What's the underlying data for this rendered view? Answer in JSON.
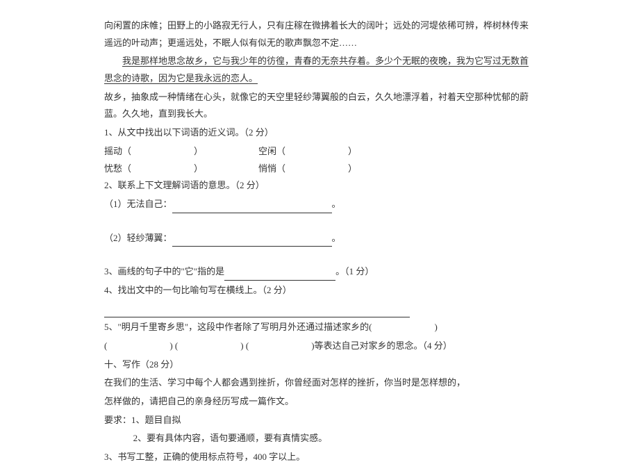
{
  "passage": {
    "p1": "向闲置的床帷；田野上的小路寂无行人，只有庄稼在微拂着长大的阔叶；远处的河堤依稀可辨，桦树林传来遥远的叶动声；更遥远处，不眠人似有似无的歌声飘忽不定……",
    "p2_underline": "我是那样地思念故乡，它与我少年的彷徨，青春的无奈共存着。多少个无眠的夜晚，我为它写过无数首思念的诗歌，因为它是我永远的恋人。",
    "p3": "故乡，抽象成一种情绪在心头，就像它的天空里轻纱薄翼般的白云，久久地漂浮着，衬着天空那种忧郁的蔚蓝。久久地，直到我长大。"
  },
  "q1": {
    "stem": "1、从文中找出以下词语的近义词。（2 分）",
    "w1": "摇动（",
    "w1_close": "）",
    "w2": "空闲（",
    "w2_close": "）",
    "w3": "忧愁（",
    "w3_close": "）",
    "w4": "悄悄（",
    "w4_close": "）"
  },
  "q2": {
    "stem": "2、联系上下文理解词语的意思。（2 分）",
    "item1": "（1）无法自己：",
    "item2": "（2）轻纱薄翼："
  },
  "q3": {
    "stem_a": "3、画线的句子中的\"它\"指的是",
    "stem_b": "。（1 分）"
  },
  "q4": {
    "stem": "4、找出文中的一句比喻句写在横线上。（2 分）"
  },
  "q5": {
    "stem_a": "5、\"明月千里寄乡思\"，这段中作者除了写明月外还通过描述家乡的(",
    "stem_b": ")",
    "row2_a": "(",
    "row2_b": ") (",
    "row2_c": ") (",
    "row2_d": ")等表达自己对家乡的思念。（4 分）"
  },
  "writing": {
    "title": "十、写作（28 分）",
    "prompt1": "在我们的生活、学习中每个人都会遇到挫折，你曾经面对怎样的挫折，你当时是怎样想的，",
    "prompt2": "怎样做的，请把自己的亲身经历写成一篇作文。",
    "req_label": "要求：1、题目自拟",
    "req2": "2、要有具体内容，语句要通顺，要有真情实感。",
    "req3": "3、书写工整，正确的使用标点符号，400 字以上。"
  }
}
